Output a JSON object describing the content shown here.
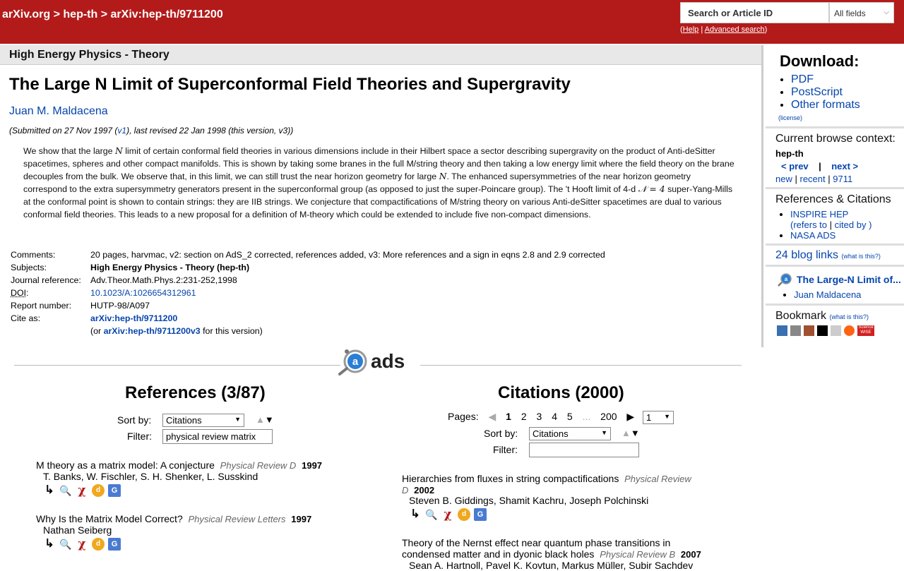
{
  "header": {
    "breadcrumb": "arXiv.org > hep-th > arXiv:hep-th/9711200",
    "search_placeholder": "Search or Article ID",
    "field_select": "All fields",
    "help_open": "(",
    "help_link": "Help",
    "help_sep": " | ",
    "advanced_link": "Advanced search",
    "help_close": ")"
  },
  "subject_bar": "High Energy Physics - Theory",
  "paper": {
    "title": "The Large N Limit of Superconformal Field Theories and Supergravity",
    "author": "Juan M. Maldacena",
    "submitted_prefix": "(Submitted on 27 Nov 1997 (",
    "v1": "v1",
    "submitted_suffix": "), last revised 22 Jan 1998 (this version, v3))",
    "abstract_1": "We show that the large ",
    "abstract_N1": "N",
    "abstract_2": " limit of certain conformal field theories in various dimensions include in their Hilbert space a sector describing supergravity on the product of Anti-deSitter spacetimes, spheres and other compact manifolds. This is shown by taking some branes in the full M/string theory and then taking a low energy limit where the field theory on the brane decouples from the bulk. We observe that, in this limit, we can still trust the near horizon geometry for large ",
    "abstract_N2": "N",
    "abstract_3": ". The enhanced supersymmetries of the near horizon geometry correspond to the extra supersymmetry generators present in the superconformal group (as opposed to just the super-Poincare group). The 't Hooft limit of 4-d ",
    "abstract_N4": "𝒩 = 4",
    "abstract_4": " super-Yang-Mills at the conformal point is shown to contain strings: they are IIB strings. We conjecture that compactifications of M/string theory on various Anti-deSitter spacetimes are dual to various conformal field theories. This leads to a new proposal for a definition of M-theory which could be extended to include five non-compact dimensions."
  },
  "meta": {
    "comments_label": "Comments:",
    "comments": "20 pages, harvmac, v2: section on AdS_2 corrected, references added, v3: More references and a sign in eqns 2.8 and 2.9 corrected",
    "subjects_label": "Subjects:",
    "subjects": "High Energy Physics - Theory (hep-th)",
    "journal_label": "Journal reference:",
    "journal": "Adv.Theor.Math.Phys.2:231-252,1998",
    "doi_label": "DOI",
    "doi_colon": ":",
    "doi": "10.1023/A:1026654312961",
    "report_label": "Report number:",
    "report": "HUTP-98/A097",
    "cite_label": "Cite as:",
    "cite": "arXiv:hep-th/9711200",
    "cite2_prefix": "(or ",
    "cite2": "arXiv:hep-th/9711200v3",
    "cite2_suffix": " for this version)"
  },
  "ads": {
    "logo_text": "ads",
    "refs_title": "References (3/87)",
    "cites_title": "Citations (2000)",
    "sort_label": "Sort by:",
    "sort_value": "Citations",
    "filter_label": "Filter:",
    "refs_filter_value": "physical review matrix",
    "pages_label": "Pages:",
    "pages": [
      "1",
      "2",
      "3",
      "4",
      "5",
      "...",
      "200"
    ],
    "page_select": "1",
    "references": [
      {
        "title": "M theory as a matrix model: A conjecture",
        "journal": "Physical Review D",
        "year": "1997",
        "authors": "T. Banks,  W. Fischler,  S. H. Shenker,  L. Susskind"
      },
      {
        "title": "Why Is the Matrix Model Correct?",
        "journal": "Physical Review Letters",
        "year": "1997",
        "authors": "Nathan Seiberg"
      }
    ],
    "citations": [
      {
        "title": "Hierarchies from fluxes in string compactifications",
        "journal1": "Physical Review",
        "journal2": "D",
        "year": "2002",
        "authors": "Steven B. Giddings,  Shamit Kachru,  Joseph Polchinski"
      },
      {
        "title1": "Theory of the Nernst effect near quantum phase transitions in",
        "title2": "condensed matter and in dyonic black holes",
        "journal": "Physical Review B",
        "year": "2007",
        "authors": "Sean A. Hartnoll,  Pavel K. Kovtun,  Markus Müller,  Subir Sachdev"
      }
    ]
  },
  "sidebar": {
    "download_title": "Download:",
    "formats": [
      "PDF",
      "PostScript",
      "Other formats"
    ],
    "license": "(license)",
    "context_title": "Current browse context:",
    "context": "hep-th",
    "prev": "< prev",
    "bar": "|",
    "next": "next >",
    "new": "new",
    "recent": "recent",
    "month": "9711",
    "refs_title": "References & Citations",
    "inspire": "INSPIRE HEP",
    "refers_to": "refers to",
    "cited_by": "cited by",
    "nasa": "NASA ADS",
    "blog": "24 blog links",
    "whatis": "(what is this?)",
    "related_title": "The Large-N Limit of...",
    "related_author": "Juan Maldacena",
    "bookmark": "Bookmark",
    "science_wise": "Science WISE"
  }
}
